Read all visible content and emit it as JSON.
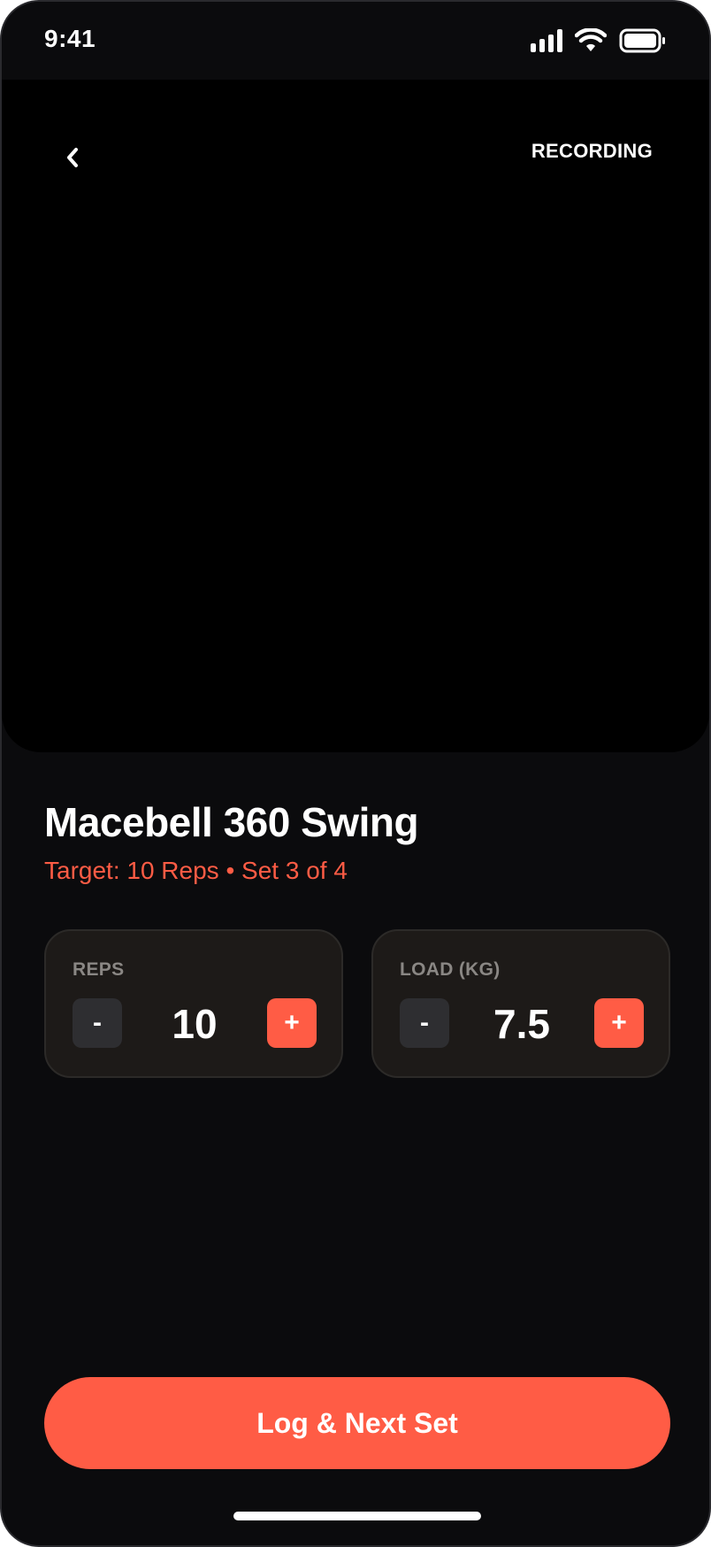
{
  "status_bar": {
    "time": "9:41",
    "icons": [
      "signal-icon",
      "wifi-icon",
      "battery-icon"
    ]
  },
  "camera": {
    "back_icon": "chevron-left-icon",
    "recording_label": "RECORDING"
  },
  "exercise": {
    "title": "Macebell 360 Swing",
    "subtitle": "Target: 10 Reps • Set 3 of 4"
  },
  "steppers": {
    "reps": {
      "label": "REPS",
      "value": "10",
      "minus": "-",
      "plus": "+"
    },
    "load": {
      "label": "LOAD (KG)",
      "value": "7.5",
      "minus": "-",
      "plus": "+"
    }
  },
  "primary_action": {
    "label": "Log & Next Set"
  },
  "colors": {
    "accent": "#ff5c45",
    "background": "#0b0b0d",
    "card": "#1d1a18",
    "muted_button": "#2e2e31",
    "label_gray": "#8a8784"
  }
}
